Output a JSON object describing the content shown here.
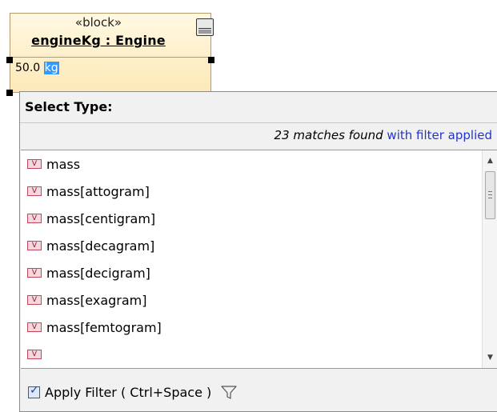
{
  "block": {
    "stereotype": "«block»",
    "name": "engineKg : Engine",
    "value_number": "50.0",
    "value_unit_selected": "kg"
  },
  "popup": {
    "title": "Select Type:",
    "match_count_text": "23 matches found",
    "filter_text": " with filter applied",
    "items": [
      {
        "label": "mass",
        "icon": "value-type-icon"
      },
      {
        "label": "mass[attogram]",
        "icon": "value-type-icon"
      },
      {
        "label": "mass[centigram]",
        "icon": "value-type-icon"
      },
      {
        "label": "mass[decagram]",
        "icon": "value-type-icon"
      },
      {
        "label": "mass[decigram]",
        "icon": "value-type-icon"
      },
      {
        "label": "mass[exagram]",
        "icon": "value-type-icon"
      },
      {
        "label": "mass[femtogram]",
        "icon": "value-type-icon"
      }
    ],
    "item_icon_letter": "V",
    "apply_filter_label": "Apply Filter ( Ctrl+Space )",
    "apply_filter_checked": true
  },
  "colors": {
    "selection": "#3399ff",
    "filter_link": "#2135cc",
    "block_fill": "#fde9b8"
  }
}
